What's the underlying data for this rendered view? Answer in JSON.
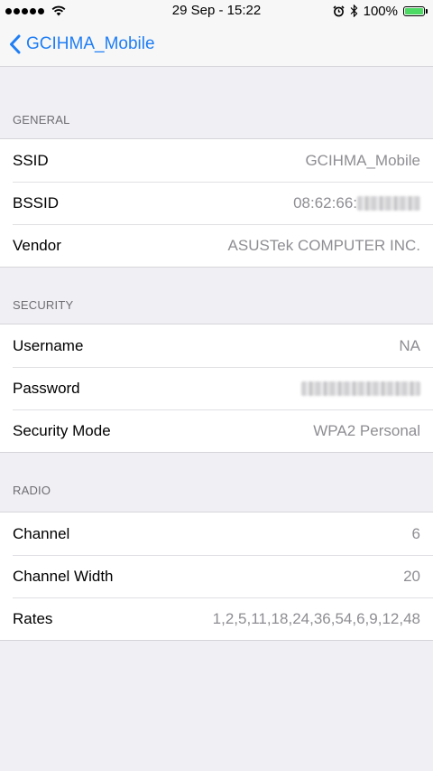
{
  "status_bar": {
    "time": "29 Sep - 15:22",
    "battery": "100%",
    "battery_color": "#4cd964"
  },
  "nav": {
    "back_title": "GCIHMA_Mobile",
    "accent_color": "#1f7ef5"
  },
  "sections": {
    "general": {
      "header": "GENERAL",
      "rows": [
        {
          "label": "SSID",
          "value": "GCIHMA_Mobile"
        },
        {
          "label": "BSSID",
          "value": "08:62:66:"
        },
        {
          "label": "Vendor",
          "value": "ASUSTek COMPUTER INC."
        }
      ]
    },
    "security": {
      "header": "SECURITY",
      "rows": [
        {
          "label": "Username",
          "value": "NA"
        },
        {
          "label": "Password",
          "value": ""
        },
        {
          "label": "Security Mode",
          "value": "WPA2 Personal"
        }
      ]
    },
    "radio": {
      "header": "RADIO",
      "rows": [
        {
          "label": "Channel",
          "value": "6"
        },
        {
          "label": "Channel Width",
          "value": "20"
        },
        {
          "label": "Rates",
          "value": "1,2,5,11,18,24,36,54,6,9,12,48"
        }
      ]
    }
  }
}
